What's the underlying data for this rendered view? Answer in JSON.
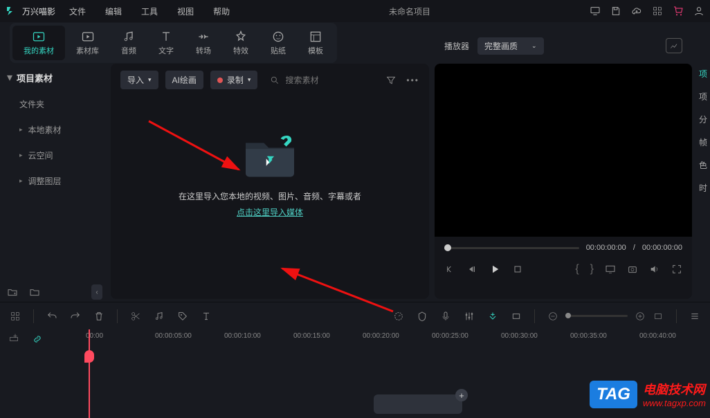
{
  "app": {
    "name": "万兴喵影",
    "project": "未命名项目"
  },
  "menu": [
    "文件",
    "编辑",
    "工具",
    "视图",
    "帮助"
  ],
  "tabs": [
    {
      "label": "我的素材",
      "icon": "media"
    },
    {
      "label": "素材库",
      "icon": "stock"
    },
    {
      "label": "音频",
      "icon": "audio"
    },
    {
      "label": "文字",
      "icon": "text"
    },
    {
      "label": "转场",
      "icon": "transition"
    },
    {
      "label": "特效",
      "icon": "effect"
    },
    {
      "label": "贴纸",
      "icon": "sticker"
    },
    {
      "label": "模板",
      "icon": "template"
    }
  ],
  "preview": {
    "header_label": "播放器",
    "quality": "完整画质",
    "current": "00:00:00:00",
    "duration": "00:00:00:00"
  },
  "sidebar": {
    "head": "项目素材",
    "items": [
      "文件夹",
      "本地素材",
      "云空间",
      "调整图层"
    ]
  },
  "media_toolbar": {
    "import": "导入",
    "ai_draw": "AI绘画",
    "record": "录制",
    "search_placeholder": "搜索素材"
  },
  "dropzone": {
    "text": "在这里导入您本地的视频、图片、音频、字幕或者",
    "link": "点击这里导入媒体"
  },
  "right_strip": [
    "项",
    "项",
    "分",
    "帧",
    "色",
    "时"
  ],
  "ruler": [
    "00:00",
    "00:00:05:00",
    "00:00:10:00",
    "00:00:15:00",
    "00:00:20:00",
    "00:00:25:00",
    "00:00:30:00",
    "00:00:35:00",
    "00:00:40:00"
  ],
  "watermark": {
    "tag": "TAG",
    "line1": "电脑技术网",
    "line2": "www.tagxp.com"
  }
}
